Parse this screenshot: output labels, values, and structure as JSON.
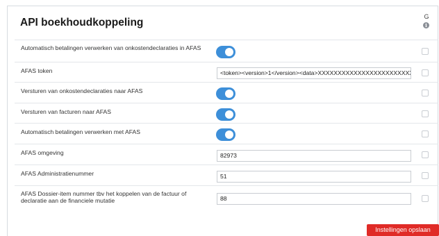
{
  "panel": {
    "title": "API boekhoudkoppeling",
    "column_header": "G",
    "info_icon": "info-icon"
  },
  "settings": [
    {
      "label": "Automatisch betalingen verwerken van onkostendeclaraties in AFAS",
      "type": "toggle",
      "value": true,
      "checked": false
    },
    {
      "label": "AFAS token",
      "type": "text",
      "value": "<token><version>1</version><data>XXXXXXXXXXXXXXXXXXXXXXXX",
      "checked": false
    },
    {
      "label": "Versturen van onkostendeclaraties naar AFAS",
      "type": "toggle",
      "value": true,
      "checked": false
    },
    {
      "label": "Versturen van facturen naar AFAS",
      "type": "toggle",
      "value": true,
      "checked": false
    },
    {
      "label": "Automatisch betalingen verwerken met AFAS",
      "type": "toggle",
      "value": true,
      "checked": false
    },
    {
      "label": "AFAS omgeving",
      "type": "text",
      "value": "82973",
      "checked": false
    },
    {
      "label": "AFAS Administratienummer",
      "type": "text",
      "value": "51",
      "checked": false
    },
    {
      "label": "AFAS Dossier-item nummer tbv het koppelen van de factuur of declaratie aan de financiele mutatie",
      "type": "text",
      "value": "88",
      "checked": false
    }
  ],
  "actions": {
    "save_label": "Instellingen opslaan"
  },
  "colors": {
    "toggle_on": "#3d8fd9",
    "save_button": "#e02b27"
  }
}
